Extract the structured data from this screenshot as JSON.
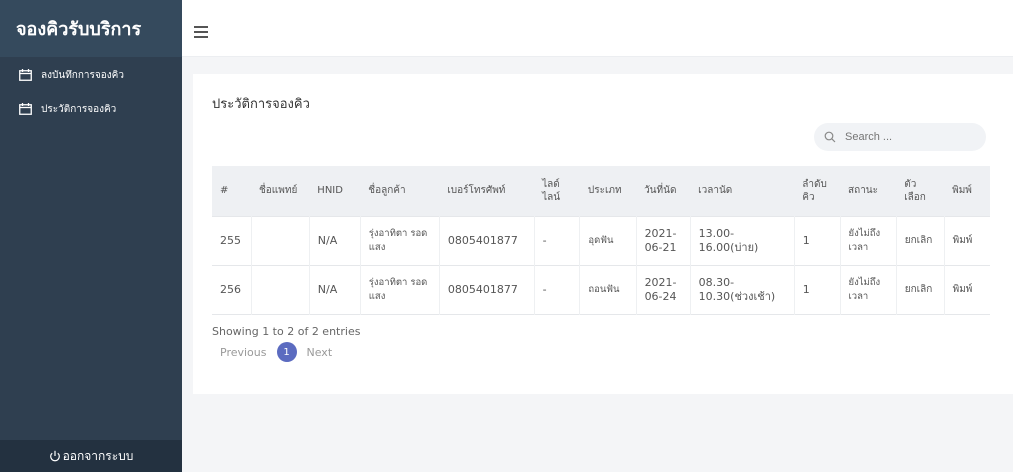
{
  "sidebar": {
    "brand": "จองคิวรับบริการ",
    "items": [
      {
        "label": "ลงบันทึกการจองคิว",
        "icon": "calendar-icon"
      },
      {
        "label": "ประวัติการจองคิว",
        "icon": "calendar-icon"
      }
    ],
    "logout_label": "ออกจากระบบ",
    "colors": {
      "sidebar": "#2f3f50",
      "brand_bg": "#354a5d",
      "logout_bg": "#233140"
    }
  },
  "topbar": {
    "menu_icon": "hamburger-icon"
  },
  "main": {
    "title": "ประวัติการจองคิว",
    "search": {
      "placeholder": "Search ...",
      "icon": "search-icon"
    },
    "table": {
      "headers": [
        "#",
        "ชื่อแพทย์",
        "HNID",
        "ชื่อลูกค้า",
        "เบอร์โทรศัพท์",
        "ไลด์ไลน์",
        "ประเภท",
        "วันที่นัด",
        "เวลานัด",
        "ลำดับคิว",
        "สถานะ",
        "ตัวเลือก",
        "พิมพ์"
      ],
      "rows": [
        {
          "no": "255",
          "doctor": "",
          "hnid": "N/A",
          "customer": "รุ่งอาทิตา รอดแสง",
          "phone": "0805401877",
          "line": "-",
          "type": "อุดฟัน",
          "date": "2021-06-21",
          "time": "13.00-16.00(บ่าย)",
          "queue": "1",
          "status": "ยังไม่ถึงเวลา",
          "option": "ยกเลิก",
          "print": "พิมพ์"
        },
        {
          "no": "256",
          "doctor": "",
          "hnid": "N/A",
          "customer": "รุ่งอาทิตา รอดแสง",
          "phone": "0805401877",
          "line": "-",
          "type": "ถอนฟัน",
          "date": "2021-06-24",
          "time": "08.30-10.30(ช่วงเช้า)",
          "queue": "1",
          "status": "ยังไม่ถึงเวลา",
          "option": "ยกเลิก",
          "print": "พิมพ์"
        }
      ]
    },
    "info": "Showing 1 to 2 of 2 entries",
    "pagination": {
      "previous": "Previous",
      "current": "1",
      "next": "Next",
      "accent": "#5b6bc0"
    }
  }
}
